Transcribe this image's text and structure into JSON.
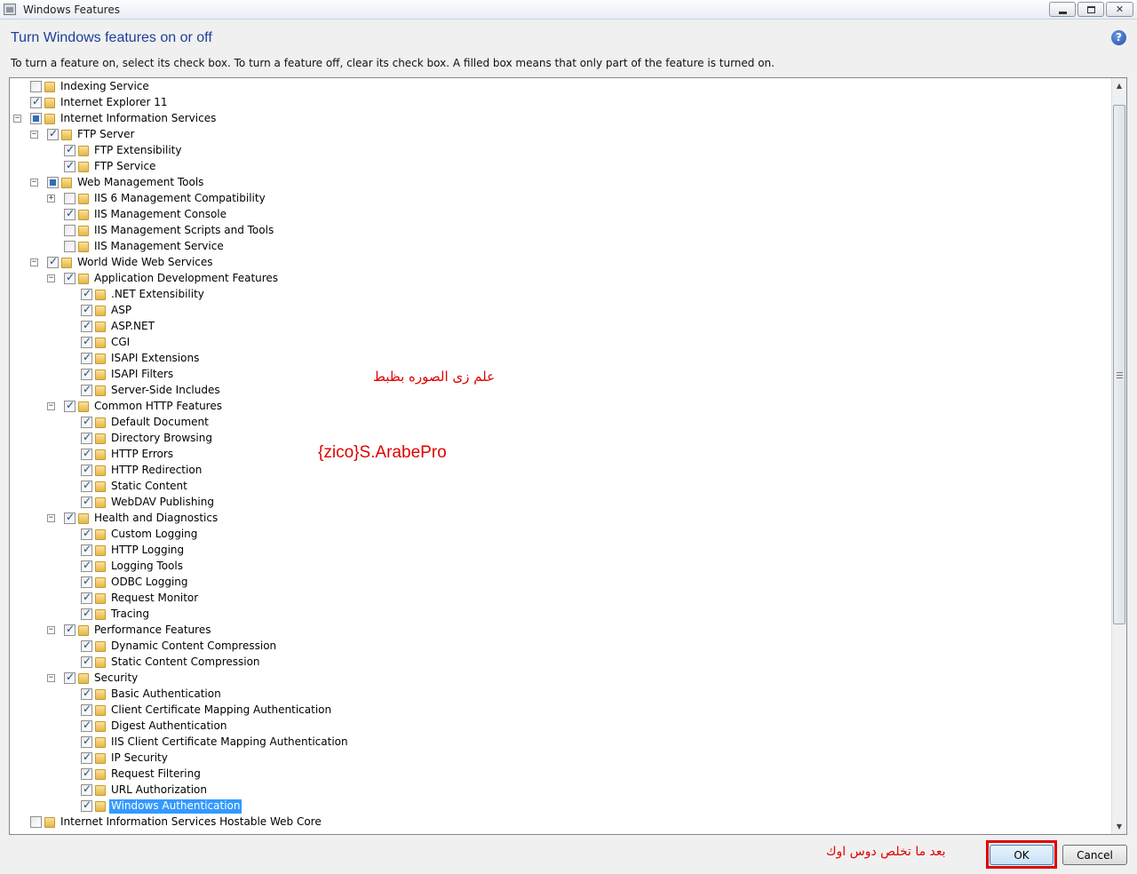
{
  "window": {
    "title": "Windows Features",
    "controls": [
      "minimize",
      "maximize",
      "close"
    ]
  },
  "header": {
    "heading": "Turn Windows features on or off",
    "instructions": "To turn a feature on, select its check box. To turn a feature off, clear its check box. A filled box means that only part of the feature is turned on.",
    "help_icon": "?"
  },
  "tree": [
    {
      "label": "Indexing Service",
      "level": 0,
      "state": "unchecked",
      "toggle": ""
    },
    {
      "label": "Internet Explorer 11",
      "level": 0,
      "state": "checked",
      "toggle": ""
    },
    {
      "label": "Internet Information Services",
      "level": 0,
      "state": "partial",
      "toggle": "collapse"
    },
    {
      "label": "FTP Server",
      "level": 1,
      "state": "checked",
      "toggle": "collapse"
    },
    {
      "label": "FTP Extensibility",
      "level": 2,
      "state": "checked",
      "toggle": ""
    },
    {
      "label": "FTP Service",
      "level": 2,
      "state": "checked",
      "toggle": ""
    },
    {
      "label": "Web Management Tools",
      "level": 1,
      "state": "partial",
      "toggle": "collapse"
    },
    {
      "label": "IIS 6 Management Compatibility",
      "level": 2,
      "state": "unchecked",
      "toggle": "expand"
    },
    {
      "label": "IIS Management Console",
      "level": 2,
      "state": "checked",
      "toggle": ""
    },
    {
      "label": "IIS Management Scripts and Tools",
      "level": 2,
      "state": "unchecked",
      "toggle": ""
    },
    {
      "label": "IIS Management Service",
      "level": 2,
      "state": "unchecked",
      "toggle": ""
    },
    {
      "label": "World Wide Web Services",
      "level": 1,
      "state": "checked",
      "toggle": "collapse"
    },
    {
      "label": "Application Development Features",
      "level": 2,
      "state": "checked",
      "toggle": "collapse"
    },
    {
      "label": ".NET Extensibility",
      "level": 3,
      "state": "checked",
      "toggle": ""
    },
    {
      "label": "ASP",
      "level": 3,
      "state": "checked",
      "toggle": ""
    },
    {
      "label": "ASP.NET",
      "level": 3,
      "state": "checked",
      "toggle": ""
    },
    {
      "label": "CGI",
      "level": 3,
      "state": "checked",
      "toggle": ""
    },
    {
      "label": "ISAPI Extensions",
      "level": 3,
      "state": "checked",
      "toggle": ""
    },
    {
      "label": "ISAPI Filters",
      "level": 3,
      "state": "checked",
      "toggle": ""
    },
    {
      "label": "Server-Side Includes",
      "level": 3,
      "state": "checked",
      "toggle": ""
    },
    {
      "label": "Common HTTP Features",
      "level": 2,
      "state": "checked",
      "toggle": "collapse"
    },
    {
      "label": "Default Document",
      "level": 3,
      "state": "checked",
      "toggle": ""
    },
    {
      "label": "Directory Browsing",
      "level": 3,
      "state": "checked",
      "toggle": ""
    },
    {
      "label": "HTTP Errors",
      "level": 3,
      "state": "checked",
      "toggle": ""
    },
    {
      "label": "HTTP Redirection",
      "level": 3,
      "state": "checked",
      "toggle": ""
    },
    {
      "label": "Static Content",
      "level": 3,
      "state": "checked",
      "toggle": ""
    },
    {
      "label": "WebDAV Publishing",
      "level": 3,
      "state": "checked",
      "toggle": ""
    },
    {
      "label": "Health and Diagnostics",
      "level": 2,
      "state": "checked",
      "toggle": "collapse"
    },
    {
      "label": "Custom Logging",
      "level": 3,
      "state": "checked",
      "toggle": ""
    },
    {
      "label": "HTTP Logging",
      "level": 3,
      "state": "checked",
      "toggle": ""
    },
    {
      "label": "Logging Tools",
      "level": 3,
      "state": "checked",
      "toggle": ""
    },
    {
      "label": "ODBC Logging",
      "level": 3,
      "state": "checked",
      "toggle": ""
    },
    {
      "label": "Request Monitor",
      "level": 3,
      "state": "checked",
      "toggle": ""
    },
    {
      "label": "Tracing",
      "level": 3,
      "state": "checked",
      "toggle": ""
    },
    {
      "label": "Performance Features",
      "level": 2,
      "state": "checked",
      "toggle": "collapse"
    },
    {
      "label": "Dynamic Content Compression",
      "level": 3,
      "state": "checked",
      "toggle": ""
    },
    {
      "label": "Static Content Compression",
      "level": 3,
      "state": "checked",
      "toggle": ""
    },
    {
      "label": "Security",
      "level": 2,
      "state": "checked",
      "toggle": "collapse"
    },
    {
      "label": "Basic Authentication",
      "level": 3,
      "state": "checked",
      "toggle": ""
    },
    {
      "label": "Client Certificate Mapping Authentication",
      "level": 3,
      "state": "checked",
      "toggle": ""
    },
    {
      "label": "Digest Authentication",
      "level": 3,
      "state": "checked",
      "toggle": ""
    },
    {
      "label": "IIS Client Certificate Mapping Authentication",
      "level": 3,
      "state": "checked",
      "toggle": ""
    },
    {
      "label": "IP Security",
      "level": 3,
      "state": "checked",
      "toggle": ""
    },
    {
      "label": "Request Filtering",
      "level": 3,
      "state": "checked",
      "toggle": ""
    },
    {
      "label": "URL Authorization",
      "level": 3,
      "state": "checked",
      "toggle": ""
    },
    {
      "label": "Windows Authentication",
      "level": 3,
      "state": "checked",
      "toggle": "",
      "selected": true
    },
    {
      "label": "Internet Information Services Hostable Web Core",
      "level": 0,
      "state": "unchecked",
      "toggle": ""
    }
  ],
  "annotations": {
    "arabic_note": "علم زى الصوره بظبط",
    "watermark": "{zico}S.ArabePro",
    "ok_note": "بعد ما تخلص دوس اوك"
  },
  "buttons": {
    "ok": "OK",
    "cancel": "Cancel"
  },
  "colors": {
    "heading": "#1e3f9a",
    "selection": "#3399ff",
    "annotation": "#e00000"
  }
}
